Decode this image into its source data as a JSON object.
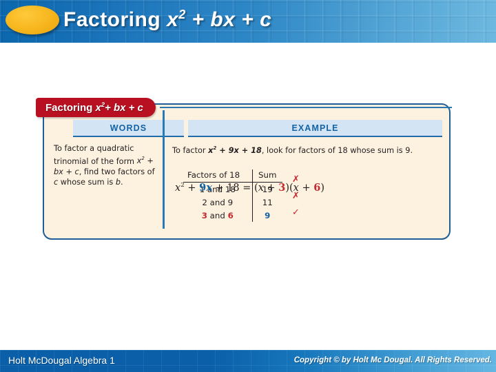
{
  "slide": {
    "title_prefix": "Factoring ",
    "title_expr_x": "x",
    "title_expr_sup": "2",
    "title_expr_rest": " + bx + c"
  },
  "card": {
    "tab_prefix": "Factoring ",
    "tab_expr_x": "x",
    "tab_expr_sup": "2",
    "tab_expr_rest": "+ bx + c",
    "columns": {
      "words_label": "WORDS",
      "example_label": "EXAMPLE"
    },
    "words": {
      "line_1": "To factor a quadratic trinomial of the form ",
      "expr_x": "x",
      "expr_sup": "2",
      "expr_rest": " + bx + c",
      "line_2": ", find two factors of ",
      "expr_c": "c",
      "line_3": " whose sum is ",
      "expr_b": "b",
      "line_4": "."
    },
    "example": {
      "intro_1": "To factor ",
      "expr_x": "x",
      "expr_sup": "2",
      "expr_rest": " + 9x + 18",
      "intro_2": ", look for factors of 18 whose sum is 9."
    }
  },
  "factor_table": {
    "headers": [
      "Factors of 18",
      "Sum"
    ],
    "rows": [
      {
        "factors_a": "1",
        "and": " and ",
        "factors_b": "18",
        "sum": "19",
        "mark": "✗",
        "highlight": false
      },
      {
        "factors_a": "2",
        "and": " and ",
        "factors_b": "9",
        "sum": "11",
        "mark": "✗",
        "highlight": false
      },
      {
        "factors_a": "3",
        "and": " and ",
        "factors_b": "6",
        "sum": "9",
        "mark": "✓",
        "highlight": true
      }
    ]
  },
  "final_equation": {
    "part_x": "x",
    "part_sup": "2",
    "part_plus1": " + ",
    "part_b": "9",
    "part_bx": "x",
    "part_plus2": " + 18 = (",
    "part_x2": "x",
    "part_plus3": " + ",
    "part_r1": "3",
    "part_mid": ")(",
    "part_x3": "x",
    "part_plus4": " + ",
    "part_r2": "6",
    "part_end": ")"
  },
  "footer": {
    "left_text": "Holt McDougal Algebra 1",
    "right_text": "Copyright © by Holt Mc Dougal. All Rights Reserved."
  },
  "colors": {
    "header_blue_dark": "#0d67ad",
    "header_blue_light": "#6db8e0",
    "tab_red": "#b81020",
    "card_cream": "#fdf1df",
    "card_border": "#1f5d96",
    "col_head_blue": "#d3e4f5",
    "label_blue": "#1463a5",
    "highlight_red": "#c3292f",
    "ellipse_gold": "#f6b51d"
  }
}
